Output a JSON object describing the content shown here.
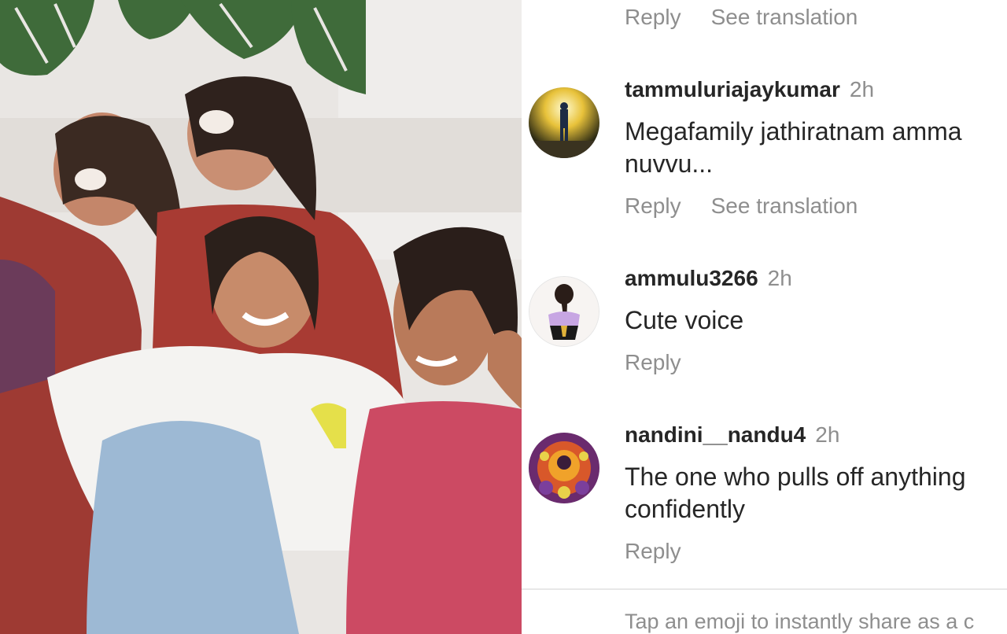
{
  "top_actions": {
    "reply_label": "Reply",
    "translate_label": "See translation"
  },
  "comments": [
    {
      "username": "tammuluriajaykumar",
      "time": "2h",
      "text_line1": "Megafamily  jathiratnam amma",
      "text_line2": "nuvvu...",
      "reply_label": "Reply",
      "translate_label": "See translation"
    },
    {
      "username": "ammulu3266",
      "time": "2h",
      "text_line1": "Cute voice",
      "reply_label": "Reply"
    },
    {
      "username": "nandini__nandu4",
      "time": "2h",
      "text_line1": "The one who pulls off anything",
      "text_line2": "confidently",
      "reply_label": "Reply"
    }
  ],
  "footer": {
    "hint": "Tap an emoji to instantly share as a c"
  },
  "colors": {
    "username": "#262626",
    "meta": "#8e8e8e",
    "divider": "#e8e8e8"
  }
}
